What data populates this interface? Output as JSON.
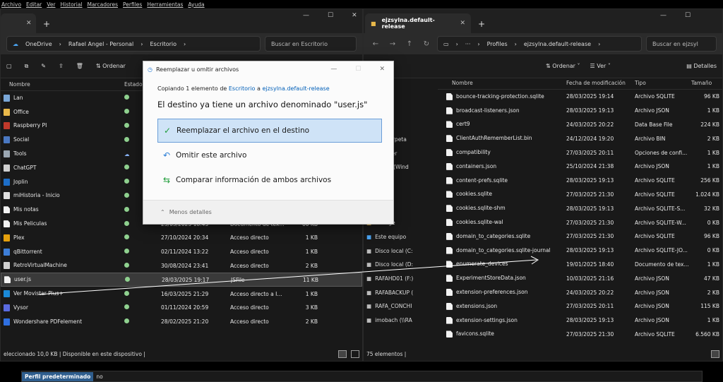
{
  "menubar": [
    "Archivo",
    "Editar",
    "Ver",
    "Historial",
    "Marcadores",
    "Perfiles",
    "Herramientas",
    "Ayuda"
  ],
  "left": {
    "tab_title": "Escritorio",
    "breadcrumb": [
      "OneDrive",
      "Rafael Angel - Personal",
      "Escritorio"
    ],
    "search_placeholder": "Buscar en Escritorio",
    "toolbar_sort": "Ordenar",
    "cols": {
      "name": "Nombre",
      "status": "Estado"
    },
    "rows": [
      {
        "name": "Lan",
        "date": "",
        "type": "",
        "size": "",
        "color": "#7aa7d8"
      },
      {
        "name": "Office",
        "date": "",
        "type": "",
        "size": "",
        "color": "#e8b84a"
      },
      {
        "name": "Raspberry PI",
        "date": "",
        "type": "",
        "size": "",
        "color": "#c0392b"
      },
      {
        "name": "Social",
        "date": "",
        "type": "",
        "size": "",
        "color": "#4a78c2"
      },
      {
        "name": "Tools",
        "date": "",
        "type": "",
        "size": "",
        "color": "#9aa6b2",
        "cloud": true
      },
      {
        "name": "ChatGPT",
        "date": "",
        "type": "",
        "size": "",
        "color": "#d0d0d0"
      },
      {
        "name": "Joplin",
        "date": "",
        "type": "",
        "size": "",
        "color": "#1d6ec8"
      },
      {
        "name": "miHistoria - Inicio",
        "date": "",
        "type": "",
        "size": "",
        "color": "#e0e0e0"
      },
      {
        "name": "Mis notas",
        "date": "",
        "type": "",
        "size": "",
        "color": "#f2f2f2"
      },
      {
        "name": "Mis Peliculas",
        "date": "23/03/2025 18:45",
        "type": "Documento de tex...",
        "size": "60 KB",
        "color": "#f2f2f2"
      },
      {
        "name": "Plex",
        "date": "27/10/2024 20:34",
        "type": "Acceso directo",
        "size": "1 KB",
        "color": "#e5a00d"
      },
      {
        "name": "qBittorrent",
        "date": "02/11/2024 13:22",
        "type": "Acceso directo",
        "size": "1 KB",
        "color": "#3d7ed8"
      },
      {
        "name": "RetroVirtualMachine",
        "date": "30/08/2024 23:41",
        "type": "Acceso directo",
        "size": "2 KB",
        "color": "#d0d0d0"
      },
      {
        "name": "user.js",
        "date": "28/03/2025 19:17",
        "type": "JSFile",
        "size": "11 KB",
        "color": "#f2f2f2",
        "selected": true
      },
      {
        "name": "Ver Movistar Plus+",
        "date": "16/03/2025 21:29",
        "type": "Acceso directo a I...",
        "size": "1 KB",
        "color": "#1b8ad8"
      },
      {
        "name": "Vysor",
        "date": "01/11/2024 20:59",
        "type": "Acceso directo",
        "size": "3 KB",
        "color": "#5a6be0"
      },
      {
        "name": "Wondershare PDFelement",
        "date": "28/02/2025 21:20",
        "type": "Acceso directo",
        "size": "2 KB",
        "color": "#2f6fe0"
      }
    ],
    "status": "eleccionado  10,0 KB  |  Disponible en este dispositivo  |"
  },
  "right": {
    "tab_title": "ejzsylna.default-release",
    "breadcrumb": [
      "Profiles",
      "ejzsylna.default-release"
    ],
    "search_placeholder": "Buscar en ejzsyl",
    "toolbar": {
      "sort": "Ordenar",
      "view": "Ver",
      "details": "Detalles"
    },
    "cols": {
      "name": "Nombre",
      "date": "Fecha de modificación",
      "type": "Tipo",
      "size": "Tamaño"
    },
    "sidebar": [
      "genes",
      "sica",
      "eos",
      "aBank",
      "eva carpeta",
      "Explorer",
      "talado (Wind",
      "",
      "ega",
      "Plus 7",
      "storage",
      "Este equipo",
      "Disco local (C:",
      "Disco local (D:",
      "RAFAHD01 (F:)",
      "RAFABACKUP (",
      "RAFA_CONCHI",
      "imobach (\\\\RA"
    ],
    "rows": [
      {
        "name": "bounce-tracking-protection.sqlite",
        "date": "28/03/2025 19:14",
        "type": "Archivo SQLITE",
        "size": "96 KB"
      },
      {
        "name": "broadcast-listeners.json",
        "date": "28/03/2025 19:13",
        "type": "Archivo JSON",
        "size": "1 KB"
      },
      {
        "name": "cert9",
        "date": "24/03/2025 20:22",
        "type": "Data Base File",
        "size": "224 KB"
      },
      {
        "name": "ClientAuthRememberList.bin",
        "date": "24/12/2024 19:20",
        "type": "Archivo BIN",
        "size": "2 KB"
      },
      {
        "name": "compatibility",
        "date": "27/03/2025 20:11",
        "type": "Opciones de confi...",
        "size": "1 KB"
      },
      {
        "name": "containers.json",
        "date": "25/10/2024 21:38",
        "type": "Archivo JSON",
        "size": "1 KB"
      },
      {
        "name": "content-prefs.sqlite",
        "date": "28/03/2025 19:13",
        "type": "Archivo SQLITE",
        "size": "256 KB"
      },
      {
        "name": "cookies.sqlite",
        "date": "27/03/2025 21:30",
        "type": "Archivo SQLITE",
        "size": "1.024 KB"
      },
      {
        "name": "cookies.sqlite-shm",
        "date": "28/03/2025 19:13",
        "type": "Archivo SQLITE-S...",
        "size": "32 KB"
      },
      {
        "name": "cookies.sqlite-wal",
        "date": "27/03/2025 21:30",
        "type": "Archivo SQLITE-W...",
        "size": "0 KB"
      },
      {
        "name": "domain_to_categories.sqlite",
        "date": "27/03/2025 21:30",
        "type": "Archivo SQLITE",
        "size": "96 KB"
      },
      {
        "name": "domain_to_categories.sqlite-journal",
        "date": "28/03/2025 19:13",
        "type": "Archivo SQLITE-JO...",
        "size": "0 KB"
      },
      {
        "name": "enumerate_devices",
        "date": "19/01/2025 18:40",
        "type": "Documento de tex...",
        "size": "1 KB"
      },
      {
        "name": "ExperimentStoreData.json",
        "date": "10/03/2025 21:16",
        "type": "Archivo JSON",
        "size": "47 KB"
      },
      {
        "name": "extension-preferences.json",
        "date": "24/03/2025 20:22",
        "type": "Archivo JSON",
        "size": "2 KB"
      },
      {
        "name": "extensions.json",
        "date": "27/03/2025 20:11",
        "type": "Archivo JSON",
        "size": "115 KB"
      },
      {
        "name": "extension-settings.json",
        "date": "28/03/2025 19:13",
        "type": "Archivo JSON",
        "size": "1 KB"
      },
      {
        "name": "favicons.sqlite",
        "date": "27/03/2025 21:30",
        "type": "Archivo SQLITE",
        "size": "6.560 KB"
      }
    ],
    "status": "75 elementos  |"
  },
  "dialog": {
    "title": "Reemplazar u omitir archivos",
    "copy_prefix": "Copiando 1 elemento de ",
    "copy_from": "Escritorio",
    "copy_mid": " a ",
    "copy_to": "ejzsylna.default-release",
    "message": "El destino ya tiene un archivo denominado \"user.js\"",
    "opt_replace": "Reemplazar el archivo en el destino",
    "opt_skip": "Omitir este archivo",
    "opt_compare": "Comparar información de ambos archivos",
    "less_details": "Menos detalles"
  },
  "bottom": {
    "tag": "Perfil predeterminado",
    "value": "no"
  }
}
